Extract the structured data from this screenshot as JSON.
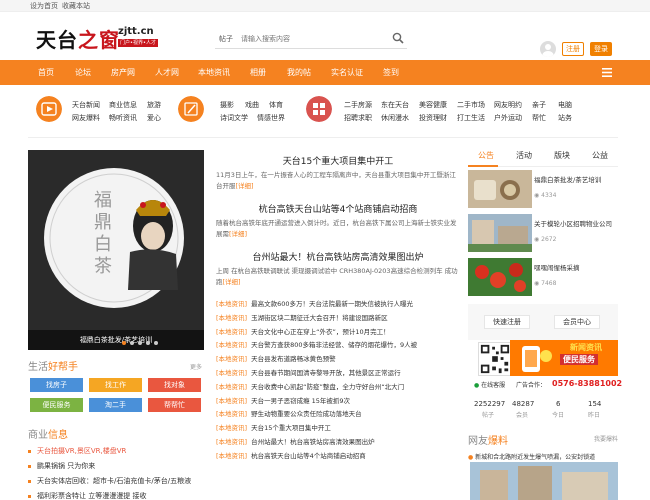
{
  "topbar": {
    "set_home": "设为首页",
    "bookmark": "收藏本站"
  },
  "logo": {
    "text_a": "天台",
    "text_b": "之窗",
    "domain": "zjtt.cn",
    "tag": "门户•视界•人才"
  },
  "search": {
    "category": "帖子",
    "placeholder": "请输入搜索内容"
  },
  "user": {
    "register": "注册",
    "login": "登录"
  },
  "nav": {
    "items": [
      "首页",
      "论坛",
      "房产网",
      "人才网",
      "本地资讯",
      "相册",
      "我的帖",
      "实名认证",
      "签到"
    ]
  },
  "categories": [
    {
      "icon": "play-icon",
      "color": "#f58220",
      "links": [
        "天台新闻",
        "商业信息",
        "旅游",
        "网友爆料",
        "畅听资讯",
        "爱心"
      ]
    },
    {
      "icon": "pencil-icon",
      "color": "#f58220",
      "links": [
        "摄影",
        "戏曲",
        "体育",
        "诗词文学",
        "情感世界"
      ]
    },
    {
      "icon": "grid-icon",
      "color": "#d9534f",
      "links": [
        "二手房源",
        "东在天台",
        "美容健康",
        "二手市场",
        "网友明约",
        "亲子",
        "电脑",
        "招聘求职",
        "休闲漫水",
        "投资理财",
        "打工生活",
        "户外运动",
        "帮忙",
        "站务"
      ]
    }
  ],
  "feature": {
    "caption": "福鼎白茶批发/茶艺培训",
    "title_art": "福鼎白茶"
  },
  "news": {
    "top": [
      {
        "title": "天台15个重大项目集中开工",
        "summary": "11月3日上午，在一片振奋人心的工程车隔离声中，天台县重大项目集中开工暨浙江台开服",
        "more": "[详细]"
      },
      {
        "title": "杭台高铁天台山站等4个站商铺启动招商",
        "summary": "随着杭台高铁年底开通运营进入倒计时。近日，杭台高铁下属公司上海新士铁实业发展需",
        "more": "[详细]"
      },
      {
        "title": "台州站最大！杭台高铁站房高清效果图出炉",
        "summary": "上周 在杭台高铁联调联试 渠现摄调试验中 CRH380AJ-0203高速综合检测列车 成功跑",
        "more": "[详细]"
      }
    ],
    "tag": "[本地资讯]",
    "list": [
      "最高文款600多万！天台法院最新一期失信被执行人曝光",
      "玉湖街区块二期征迁大会召开！将建设国路新区",
      "天台文化中心正在穿上“外衣”，预计10月完工！",
      "天台警方查获800多箱非法经营、储存的烟花爆竹，9人被",
      "天台县发布道路畅冰黄色预警",
      "天台县春节期间国清寺黎导开放，其他景区正常运行",
      "天台收费中心凯起“防疫”整盘，全力守好台州“北大门",
      "天台一男子恶窃成瘾 15年被抓9次",
      "野生动物重要公众责任险成功落地天台",
      "天台15个重大项目集中开工",
      "台州站最大！杭台高铁站房高清效果图出炉",
      "杭台高铁天台山站等4个站商铺启动招商"
    ]
  },
  "helper": {
    "title_a": "生活",
    "title_b": "好帮手",
    "more": "更多",
    "buttons": [
      {
        "label": "找房子",
        "color": "#4a90d9"
      },
      {
        "label": "找工作",
        "color": "#f5a623"
      },
      {
        "label": "找对象",
        "color": "#e9573f"
      },
      {
        "label": "便民服务",
        "color": "#7cb342"
      },
      {
        "label": "淘二手",
        "color": "#4a90d9"
      },
      {
        "label": "帮帮忙",
        "color": "#e9573f"
      }
    ]
  },
  "business": {
    "title_a": "商业",
    "title_b": "信息",
    "items": [
      {
        "text": "天台拍摄VR,景区VR,楼盘VR",
        "color": "#e9573f"
      },
      {
        "text": "鹏果锅锅 只为你来",
        "color": "#333333"
      },
      {
        "text": "天台实体店回收：超市卡/石油充值卡/茅台/五粮液",
        "color": "#333333"
      },
      {
        "text": "福利彩票含特让 立等漫漫漫提 接收",
        "color": "#333333"
      }
    ]
  },
  "tabs": [
    "公告",
    "活动",
    "版块",
    "公益"
  ],
  "threads": [
    {
      "title": "福鼎白茶批发/茶艺培训",
      "views": "4334"
    },
    {
      "title": "关于模轮小区招聘物业公司",
      "views": "2672"
    },
    {
      "title": "嘿嘿闹惺杨采摘",
      "views": "7468"
    }
  ],
  "side_buttons": [
    "快速注册",
    "会员中心"
  ],
  "promo": {
    "line1": "新闻资讯",
    "line2": "便民服务",
    "hotline_label": "广告合作：",
    "hotline": "0576-83881002",
    "wechat": "在线客服"
  },
  "stats": [
    {
      "num": "2252297",
      "label": "帖子"
    },
    {
      "num": "48287",
      "label": "会员"
    },
    {
      "num": "6",
      "label": "今日"
    },
    {
      "num": "154",
      "label": "昨日"
    }
  ],
  "friends": {
    "title_a": "网友",
    "title_b": "爆料",
    "more": "我要爆料",
    "item": "新城和合北路附近发生爆气喷漏，公安封锁道"
  }
}
